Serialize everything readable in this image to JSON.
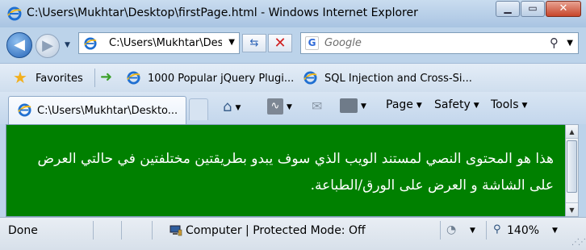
{
  "window": {
    "title": "C:\\Users\\Mukhtar\\Desktop\\firstPage.html - Windows Internet Explorer"
  },
  "navigation": {
    "address": "C:\\Users\\Mukhtar\\Des",
    "search_placeholder": "Google"
  },
  "favorites_bar": {
    "favorites_label": "Favorites",
    "items": [
      {
        "label": "1000 Popular jQuery Plugi..."
      },
      {
        "label": "SQL Injection and Cross-Si..."
      }
    ]
  },
  "tabs": [
    {
      "label": "C:\\Users\\Mukhtar\\Deskto..."
    }
  ],
  "command_bar": {
    "page_label": "Page",
    "safety_label": "Safety",
    "tools_label": "Tools"
  },
  "content": {
    "text": "هذا هو المحتوى النصي لمستند الويب الذي سوف يبدو بطريقتين مختلفتين في حالتي العرض على الشاشة و العرض على الورق/الطباعة."
  },
  "status_bar": {
    "status": "Done",
    "zone": "Computer | Protected Mode: Off",
    "zoom": "140%"
  },
  "colors": {
    "content_background": "#008000",
    "content_text": "#ffffff"
  }
}
